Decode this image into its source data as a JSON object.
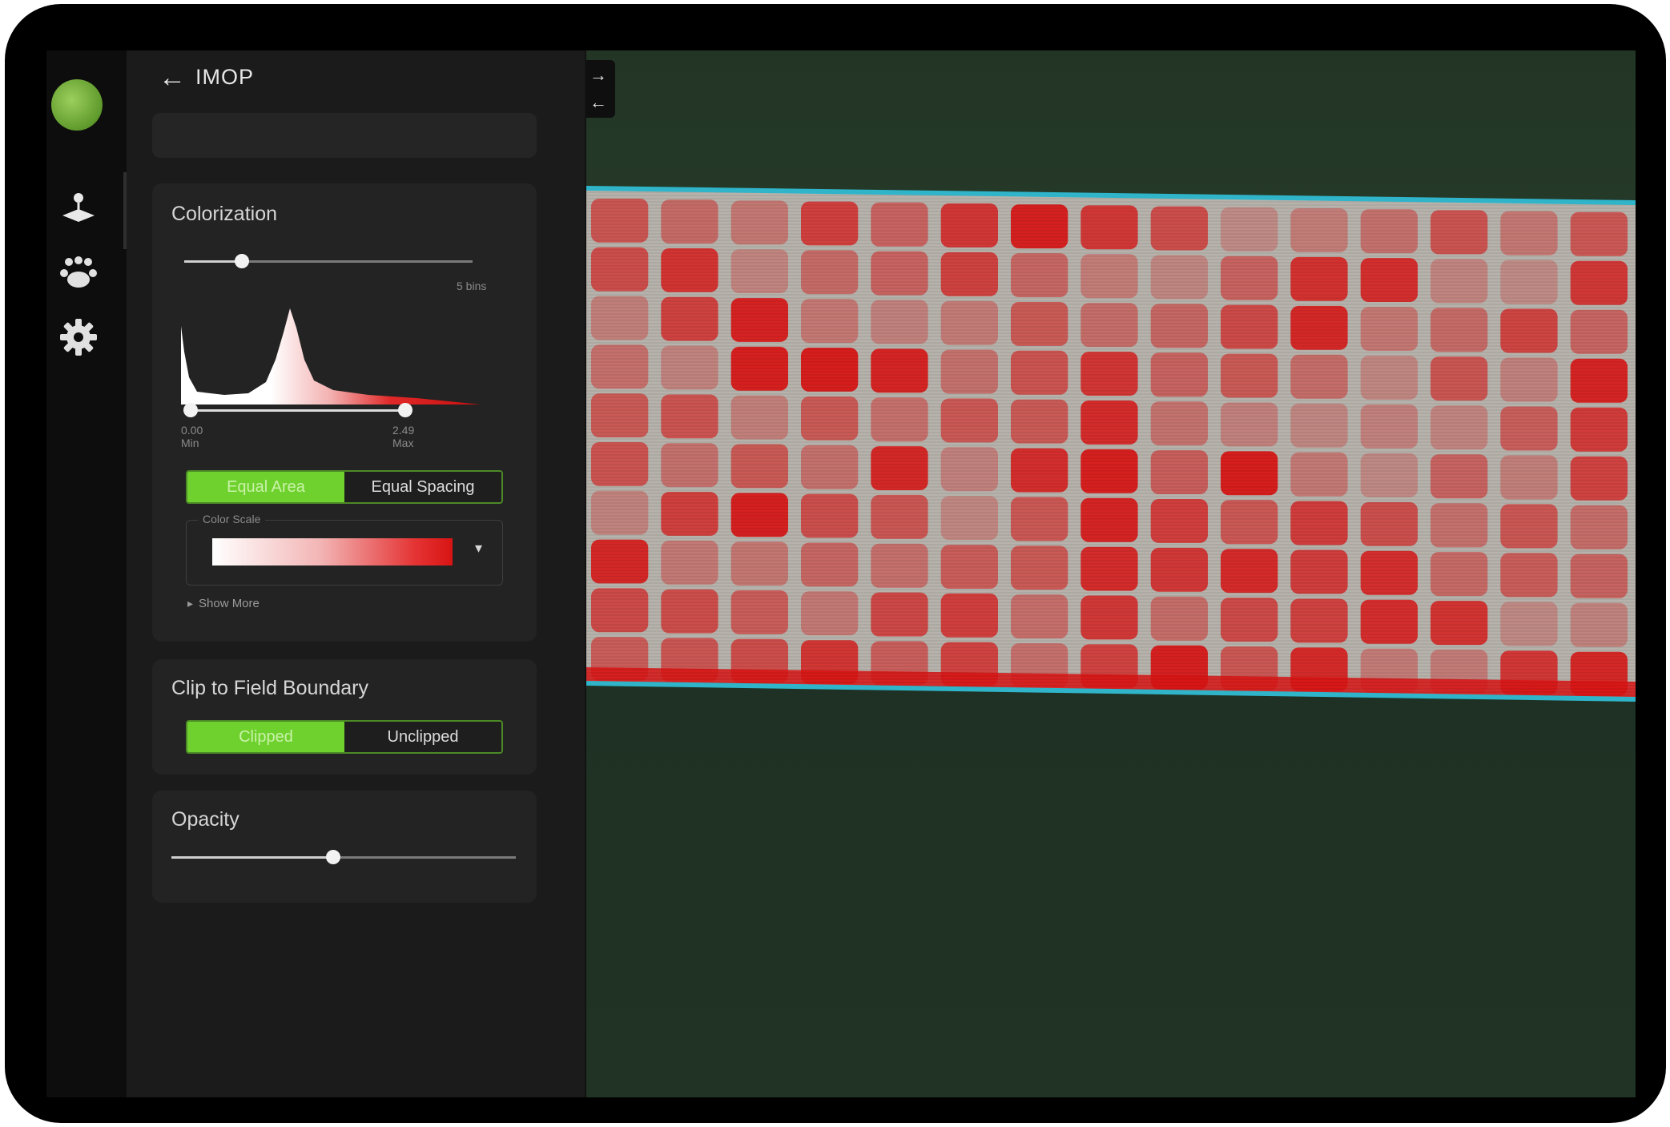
{
  "panel": {
    "back_icon": "arrow-left-icon",
    "title": "IMOP"
  },
  "rail": {
    "icons": [
      "field-location-icon",
      "team-icon",
      "gear-icon"
    ]
  },
  "colorization": {
    "title": "Colorization",
    "bins_slider_value": 0.2,
    "bins_label": "5 bins",
    "range_min_value": "0.00",
    "range_min_label": "Min",
    "range_max_value": "2.49",
    "range_max_label": "Max",
    "mode_options": [
      "Equal Area",
      "Equal Spacing"
    ],
    "mode_selected": "Equal Area",
    "color_scale_label": "Color Scale",
    "show_more": "Show More"
  },
  "clip": {
    "title": "Clip to Field Boundary",
    "options": [
      "Clipped",
      "Unclipped"
    ],
    "selected": "Clipped"
  },
  "opacity": {
    "title": "Opacity",
    "value": 0.47
  },
  "map": {
    "expand_icon": "arrow-right-icon",
    "collapse_icon": "arrow-left-icon",
    "boundary_color": "#2fb4c9"
  },
  "colors": {
    "accent_green": "#6fd12e",
    "heat_red": "#d81414"
  }
}
